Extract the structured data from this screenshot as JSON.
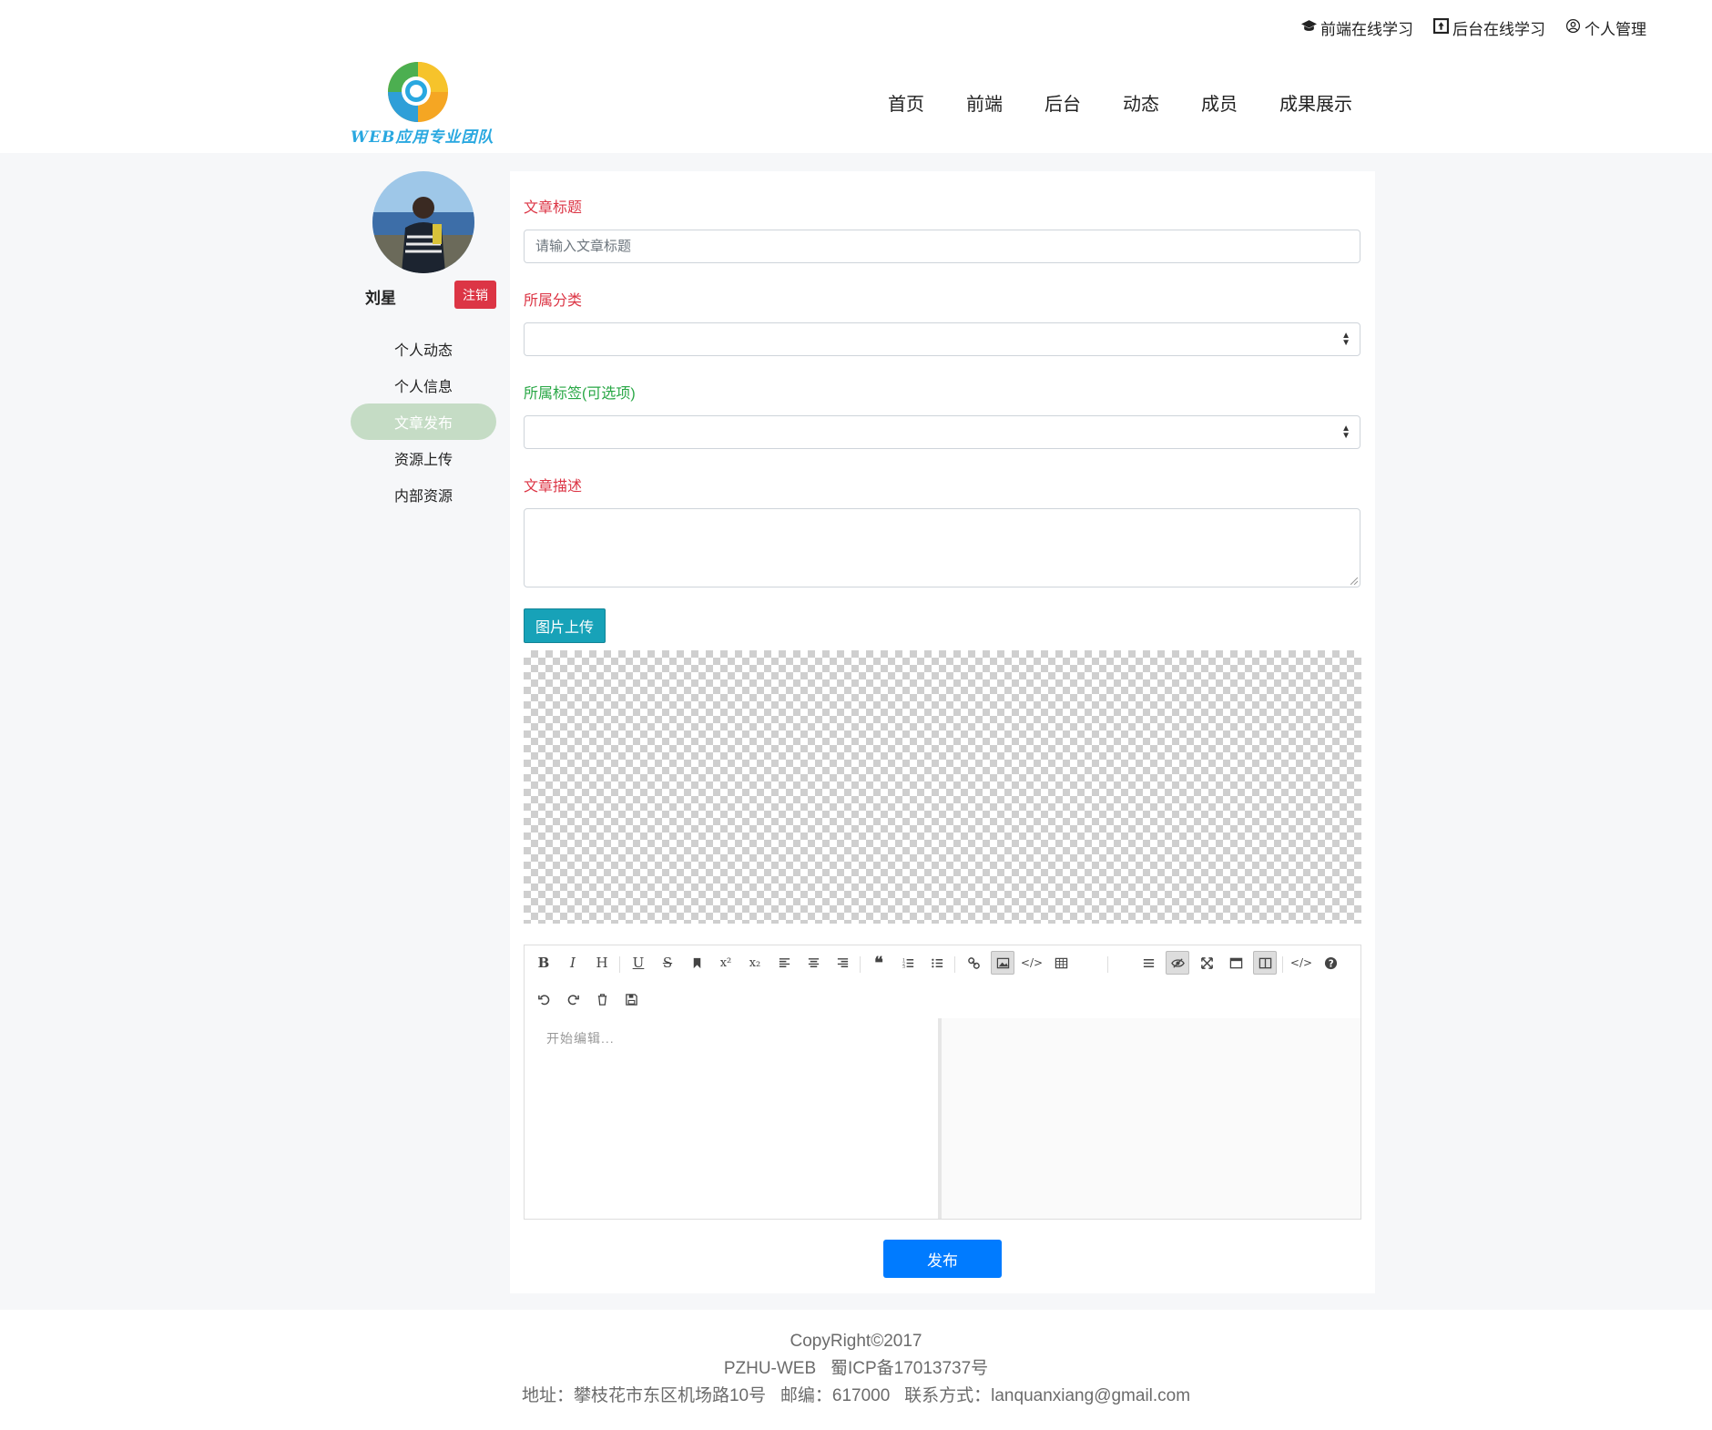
{
  "top_links": [
    {
      "icon": "graduation-cap-icon",
      "label": "前端在线学习"
    },
    {
      "icon": "upload-box-icon",
      "label": "后台在线学习"
    },
    {
      "icon": "user-circle-icon",
      "label": "个人管理"
    }
  ],
  "brand": {
    "logo_text": "WEB应用专业团队"
  },
  "nav": [
    "首页",
    "前端",
    "后台",
    "动态",
    "成员",
    "成果展示"
  ],
  "sidebar": {
    "username": "刘星",
    "logout_label": "注销",
    "menu": [
      "个人动态",
      "个人信息",
      "文章发布",
      "资源上传",
      "内部资源"
    ],
    "active_index": 2
  },
  "form": {
    "title_label": "文章标题",
    "title_placeholder": "请输入文章标题",
    "title_value": "",
    "category_label": "所属分类",
    "category_value": "",
    "tag_label": "所属标签(可选项)",
    "tag_value": "",
    "desc_label": "文章描述",
    "desc_value": "",
    "upload_label": "图片上传",
    "editor_placeholder": "开始编辑...",
    "publish_label": "发布"
  },
  "colors": {
    "required_label": "#dc3545",
    "optional_label": "#28a745",
    "publish_button": "#007bff",
    "upload_button": "#17a2b8",
    "sidebar_active": "#c5dcc5",
    "logout_button": "#dc3545"
  },
  "editor_toolbar_icons": [
    "bold-icon",
    "italic-icon",
    "heading-icon",
    "underline-icon",
    "strikethrough-icon",
    "bookmark-icon",
    "superscript-icon",
    "subscript-icon",
    "align-left-icon",
    "align-center-icon",
    "align-right-icon",
    "quote-icon",
    "ordered-list-icon",
    "unordered-list-icon",
    "link-icon",
    "image-icon",
    "code-icon",
    "table-icon",
    "menu-icon",
    "preview-icon",
    "fullscreen-icon",
    "window-icon",
    "split-view-icon",
    "source-code-icon",
    "help-icon",
    "undo-icon",
    "redo-icon",
    "trash-icon",
    "save-icon"
  ],
  "footer": {
    "copyright": "CopyRight©2017",
    "icp": "PZHU-WEB   蜀ICP备17013737号",
    "address": "地址：攀枝花市东区机场路10号   邮编：617000   联系方式：lanquanxiang@gmail.com"
  }
}
